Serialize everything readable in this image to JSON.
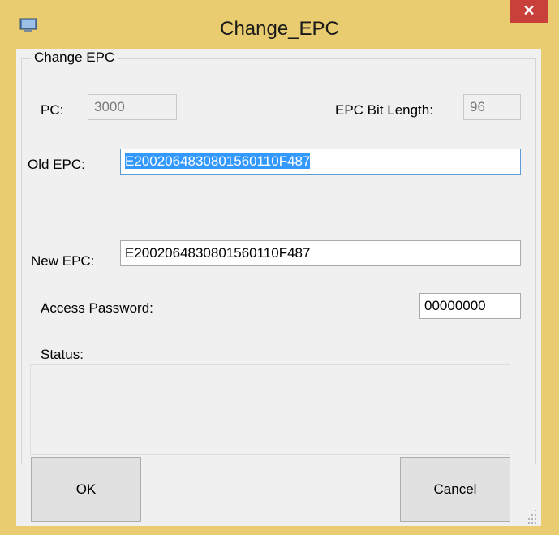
{
  "window": {
    "title": "Change_EPC",
    "close_glyph": "✕",
    "app_icon": "app-window-icon"
  },
  "group": {
    "title": "Change EPC"
  },
  "pc": {
    "label": "PC:",
    "value": "3000"
  },
  "epc_bit_length": {
    "label": "EPC Bit Length:",
    "value": "96"
  },
  "old_epc": {
    "label": "Old EPC:",
    "value": "E2002064830801560110F487"
  },
  "new_epc": {
    "label": "New EPC:",
    "value": "E2002064830801560110F487"
  },
  "access_password": {
    "label": "Access Password:",
    "value": "00000000"
  },
  "status": {
    "label": "Status:",
    "value": ""
  },
  "buttons": {
    "ok": "OK",
    "cancel": "Cancel"
  },
  "colors": {
    "titlebar": "#e9cc6f",
    "close": "#c9403a",
    "selection": "#3399ff",
    "focus_border": "#5b9bd5"
  }
}
